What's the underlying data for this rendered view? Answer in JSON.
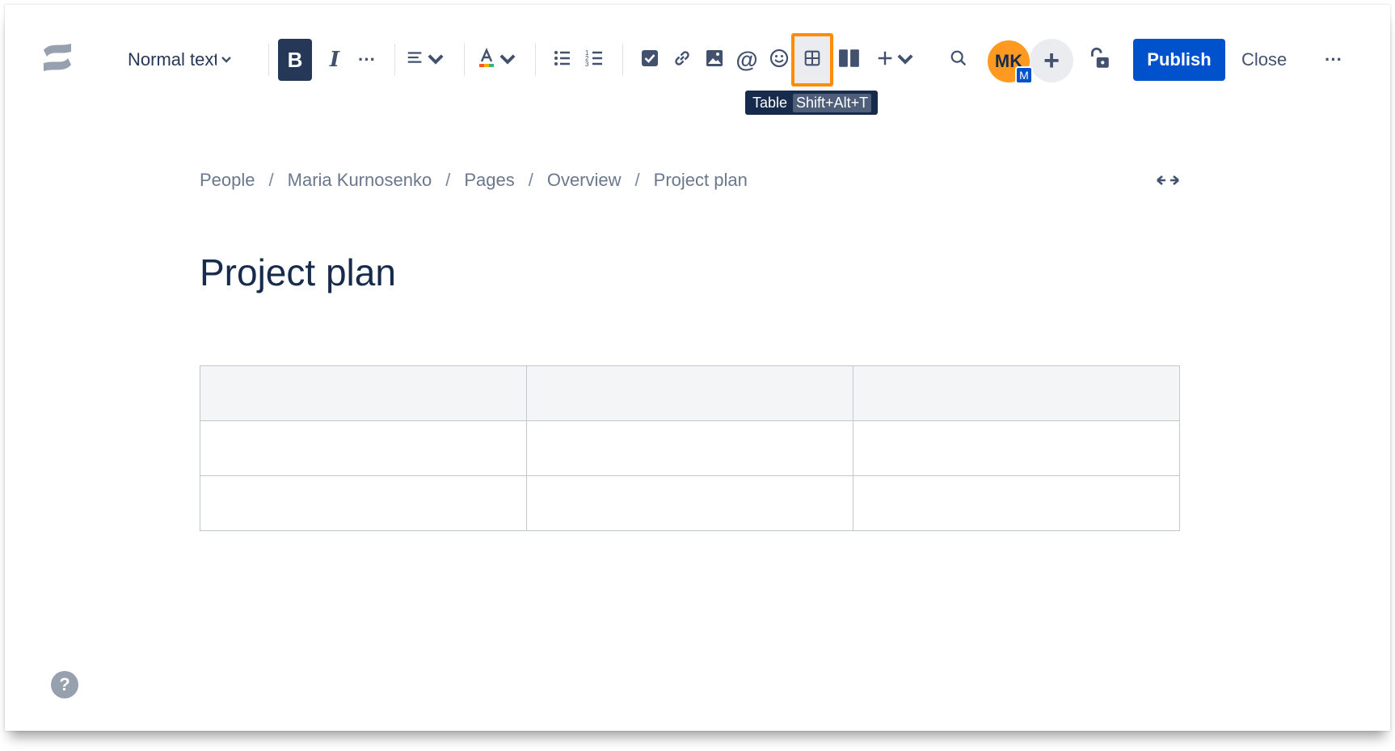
{
  "toolbar": {
    "logo_icon": "confluence-logo-icon",
    "text_style": "Normal text",
    "bold_label": "B",
    "italic_label": "I",
    "more_formatting_label": "···",
    "publish_label": "Publish",
    "close_label": "Close",
    "more_label": "···",
    "avatar_initials": "MK",
    "avatar_badge": "M",
    "add_collaborator_label": "+"
  },
  "tooltip": {
    "label": "Table",
    "shortcut": "Shift+Alt+T"
  },
  "breadcrumb": [
    "People",
    "Maria Kurnosenko",
    "Pages",
    "Overview",
    "Project plan"
  ],
  "breadcrumb_separator": "/",
  "page": {
    "title": "Project plan"
  },
  "table": {
    "columns": 3,
    "rows": [
      [
        "",
        "",
        ""
      ],
      [
        "",
        "",
        ""
      ],
      [
        "",
        "",
        ""
      ]
    ]
  },
  "help_label": "?",
  "colors": {
    "primary": "#0052cc",
    "highlight": "#ff8b00",
    "avatar": "#ff991f",
    "text": "#172b4d"
  }
}
